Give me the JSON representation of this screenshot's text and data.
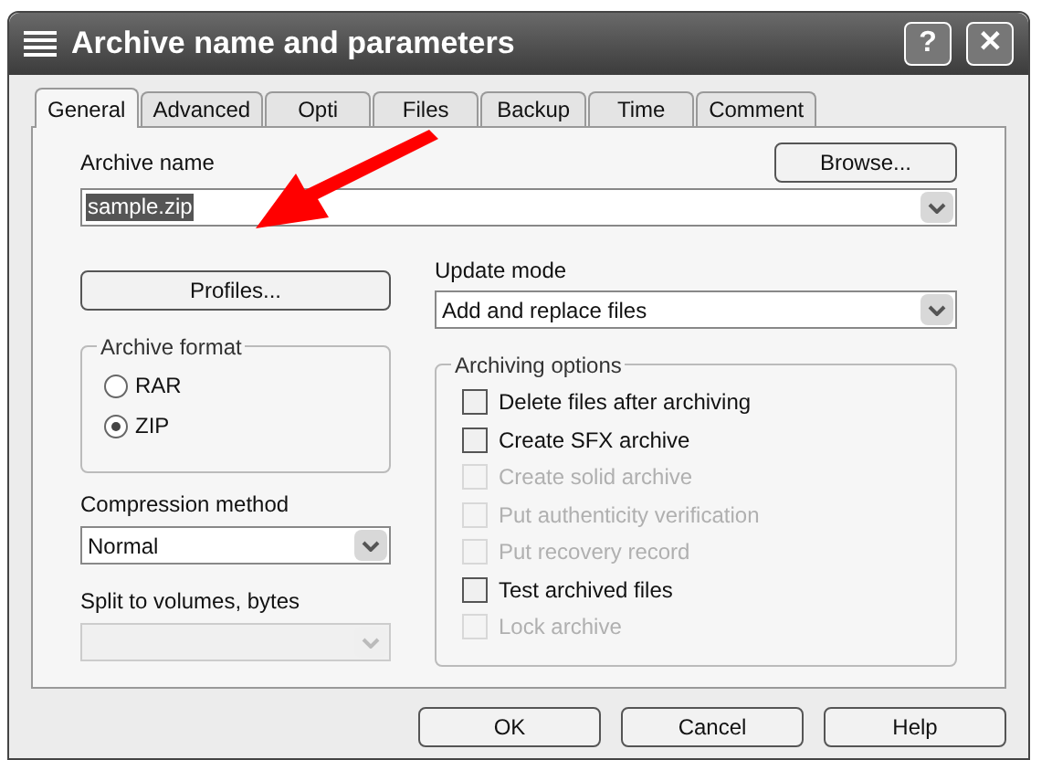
{
  "window": {
    "title": "Archive name and parameters",
    "title_buttons": [
      "?",
      "✕"
    ]
  },
  "tabs": [
    {
      "label": "General",
      "selected": true
    },
    {
      "label": "Advanced",
      "selected": false
    },
    {
      "label": "Opti",
      "selected": false
    },
    {
      "label": "Files",
      "selected": false
    },
    {
      "label": "Backup",
      "selected": false
    },
    {
      "label": "Time",
      "selected": false
    },
    {
      "label": "Comment",
      "selected": false
    }
  ],
  "archive_name": {
    "label": "Archive name",
    "value": "sample.zip",
    "browse_button": "Browse..."
  },
  "profiles_button": "Profiles...",
  "update_mode": {
    "label": "Update mode",
    "value": "Add and replace files"
  },
  "archive_format": {
    "title": "Archive format",
    "options": [
      {
        "label": "RAR",
        "selected": false
      },
      {
        "label": "ZIP",
        "selected": true
      }
    ]
  },
  "compression_method": {
    "label": "Compression method",
    "value": "Normal"
  },
  "split_volumes": {
    "label": "Split to volumes, bytes",
    "disabled": true
  },
  "archiving_options": {
    "title": "Archiving options",
    "items": [
      {
        "label": "Delete files after archiving",
        "checked": false,
        "disabled": false
      },
      {
        "label": "Create SFX archive",
        "checked": false,
        "disabled": false
      },
      {
        "label": "Create solid archive",
        "checked": false,
        "disabled": true
      },
      {
        "label": "Put authenticity verification",
        "checked": false,
        "disabled": true
      },
      {
        "label": "Put recovery record",
        "checked": false,
        "disabled": true
      },
      {
        "label": "Test archived files",
        "checked": false,
        "disabled": false
      },
      {
        "label": "Lock archive",
        "checked": false,
        "disabled": true
      }
    ]
  },
  "buttons": [
    "OK",
    "Cancel",
    "Help"
  ]
}
